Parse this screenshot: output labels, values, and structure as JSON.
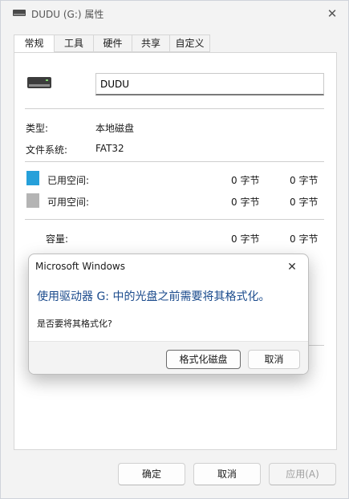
{
  "window": {
    "title": "DUDU (G:) 属性",
    "title_icon": "drive-icon",
    "close_glyph": "✕"
  },
  "tabs": [
    {
      "label": "常规",
      "active": true
    },
    {
      "label": "工具",
      "active": false
    },
    {
      "label": "硬件",
      "active": false
    },
    {
      "label": "共享",
      "active": false
    },
    {
      "label": "自定义",
      "active": false
    }
  ],
  "general": {
    "drive_name": "DUDU",
    "type_label": "类型:",
    "type_value": "本地磁盘",
    "fs_label": "文件系统:",
    "fs_value": "FAT32",
    "used_label": "已用空间:",
    "used_bytes": "0 字节",
    "used_size": "0 字节",
    "free_label": "可用空间:",
    "free_bytes": "0 字节",
    "free_size": "0 字节",
    "capacity_label": "容量:",
    "capacity_bytes": "0 字节",
    "capacity_size": "0 字节",
    "used_color": "#26a0da",
    "free_color": "#b4b4b4"
  },
  "footer": {
    "ok": "确定",
    "cancel": "取消",
    "apply": "应用(A)"
  },
  "dialog": {
    "title": "Microsoft Windows",
    "close_glyph": "✕",
    "heading": "使用驱动器 G: 中的光盘之前需要将其格式化。",
    "question": "是否要将其格式化?",
    "format_button": "格式化磁盘",
    "cancel_button": "取消"
  }
}
